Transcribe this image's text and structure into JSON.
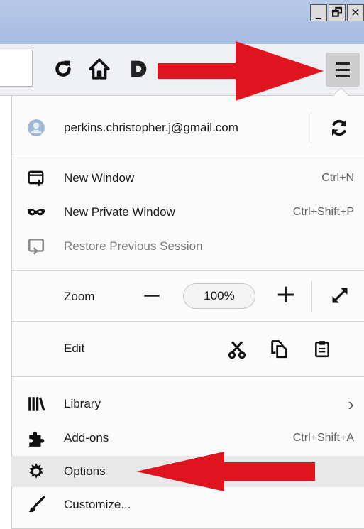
{
  "window": {
    "minimize_glyph": "_",
    "restore_glyph": "🗗",
    "close_glyph": "✕"
  },
  "account": {
    "email": "perkins.christopher.j@gmail.com"
  },
  "menu": {
    "new_window": {
      "label": "New Window",
      "shortcut": "Ctrl+N"
    },
    "new_private_window": {
      "label": "New Private Window",
      "shortcut": "Ctrl+Shift+P"
    },
    "restore_session": {
      "label": "Restore Previous Session"
    },
    "zoom": {
      "label": "Zoom",
      "value": "100%",
      "minus": "−",
      "plus": "+"
    },
    "edit": {
      "label": "Edit"
    },
    "library": {
      "label": "Library",
      "chevron": "›"
    },
    "addons": {
      "label": "Add-ons",
      "shortcut": "Ctrl+Shift+A"
    },
    "options": {
      "label": "Options"
    },
    "customize": {
      "label": "Customize..."
    }
  },
  "colors": {
    "annotation_arrow": "#e0141e",
    "titlebar": "#a6bce1",
    "highlight": "#e8e8e8"
  }
}
